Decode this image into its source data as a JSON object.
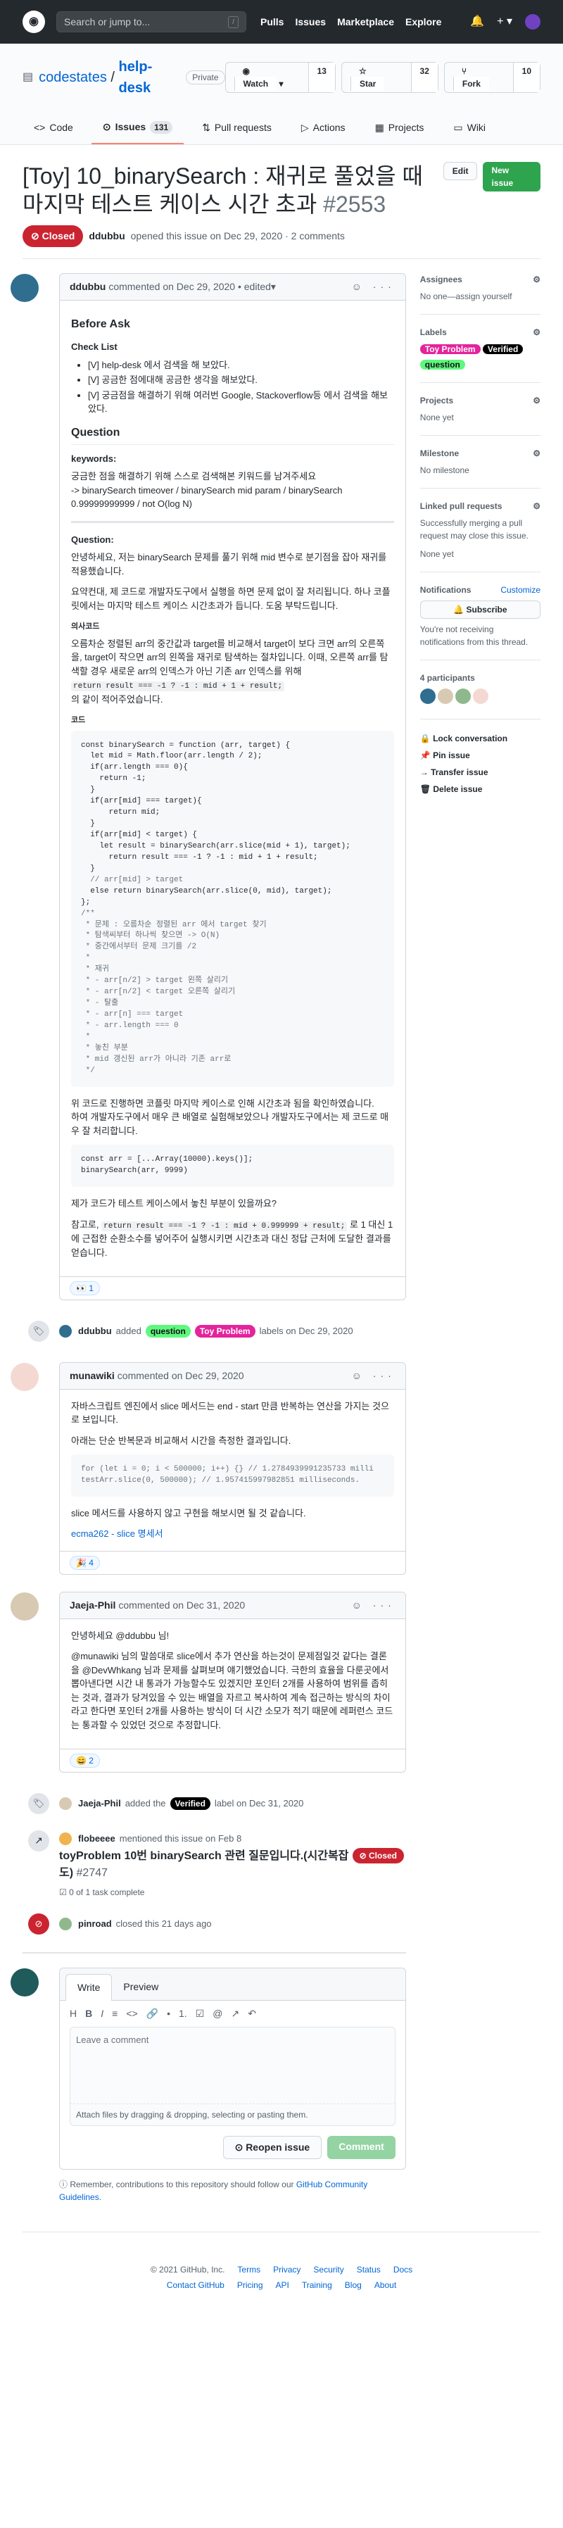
{
  "header": {
    "search_placeholder": "Search or jump to...",
    "search_key": "/",
    "nav": [
      "Pulls",
      "Issues",
      "Marketplace",
      "Explore"
    ]
  },
  "repo": {
    "owner": "codestates",
    "sep": " / ",
    "name": "help-desk",
    "visibility": "Private",
    "watch": "Watch",
    "watch_count": "13",
    "star": "Star",
    "star_count": "32",
    "fork": "Fork",
    "fork_count": "10"
  },
  "tabs": [
    {
      "label": "Code"
    },
    {
      "label": "Issues",
      "count": "131"
    },
    {
      "label": "Pull requests"
    },
    {
      "label": "Actions"
    },
    {
      "label": "Projects"
    },
    {
      "label": "Wiki"
    }
  ],
  "issue": {
    "title": "[Toy] 10_binarySearch : 재귀로 풀었을 때 마지막 테스트 케이스 시간 초과",
    "number": "#2553",
    "edit": "Edit",
    "new_issue": "New issue",
    "state": "Closed",
    "author": "ddubbu",
    "opened": "opened this issue on Dec 29, 2020 · 2 comments"
  },
  "c1": {
    "author": "ddubbu",
    "meta": "commented on Dec 29, 2020 • edited",
    "before_ask": "Before Ask",
    "checklist_title": "Check List",
    "checklist": [
      "[V] help-desk 에서 검색을 해 보았다.",
      "[V] 공금한 점에대해 공금한 생각을 해보았다.",
      "[V] 궁금점을 해결하기 위해 여러번 Google, Stackoverflow등 에서 검색을 해보았다."
    ],
    "question_h": "Question",
    "keywords_h": "keywords:",
    "kw1": "궁금한 점을 해결하기 위해 스스로 검색해본 키워드를 남겨주세요",
    "kw2": "-> binarySearch timeover / binarySearch mid param / binarySearch",
    "kw3": "0.99999999999 / not O(log N)",
    "q2_h": "Question:",
    "q_p1": "안녕하세요, 저는 binarySearch 문제를 풀기 위해 mid 변수로 분기점을 잡아 재귀를 적용했습니다.",
    "q_p2": "요약컨대, 제 코드로 개발자도구에서 실행을 하면 문제 없이 잘 처리됩니다. 하나 코플릿에서는 마지막 테스트 케이스 시간초과가 듭니다. 도움 부탁드립니다.",
    "shot_h": "의사코드",
    "q_p3": "오름차순 정렬된 arr의 중간값과 target를 비교해서 target이 보다 크면 arr의 오른쪽을, target이 작으면 arr의 왼쪽을 재귀로 탐색하는 절차입니다. 이때, 오른쪽 arr를 탐색할 경우 새로운 arr의 인덱스가 아닌 기존 arr 인덱스를 위해",
    "q_code": "return result === -1 ? -1 : mid + 1 + result;",
    "q_p4": "의 같이 적어주었습니다.",
    "code_h": "코드",
    "code": [
      "const binarySearch = function (arr, target) {",
      "  let mid = Math.floor(arr.length / 2);",
      "  if(arr.length === 0){",
      "    return -1;",
      "  }",
      "  if(arr[mid] === target){",
      "      return mid;",
      "  }",
      "  if(arr[mid] < target) {",
      "    let result = binarySearch(arr.slice(mid + 1), target);",
      "      return result === -1 ? -1 : mid + 1 + result;",
      "  }",
      "  // arr[mid] > target",
      "  else return binarySearch(arr.slice(0, mid), target);",
      "};",
      "/**",
      " * 문제 : 오름차순 정렬된 arr 에서 target 찾기",
      " * 탐색씨부터 하나씩 찾으면 -> O(N)",
      " * 중간에서부터 문제 크기를 /2",
      " *",
      " * 재귀",
      " * - arr[n/2] > target 왼쪽 살리기",
      " * - arr[n/2] < target 오른쪽 살리기",
      " * - 탈출",
      " * - arr[n] === target",
      " * - arr.length === 0",
      " *",
      " * 놓친 부분",
      " * mid 갱신된 arr가 아니라 기존 arr로",
      " */"
    ],
    "q_p5": "위 코드로 진행하면 코플릿 마지막 케이스로 인해 시간초과 됨을 확인하였습니다.",
    "q_p6": "하여 개발자도구에서 매우 큰 배열로 실험해보았으나 개발자도구에서는 제 코드로 매우 잘 처리합니다.",
    "code2": [
      "const arr = [...Array(10000).keys()];",
      "binarySearch(arr, 9999)"
    ],
    "q_p7": "제가 코드가 테스트 케이스에서 놓친 부분이 있을까요?",
    "q_p8a": "참고로,",
    "q_p8code": "return result === -1 ? -1 : mid + 0.999999 + result;",
    "q_p8b": "로 1 대신 1에 근접한 순환소수를 넣어주어 실행시키면 시간초과 대신 정답 근처에 도달한 결과를 얻습니다.",
    "reaction": "👀 1"
  },
  "ev1": {
    "actor": "ddubbu",
    "added": "added",
    "l1": "question",
    "l2": "Toy Problem",
    "suffix": "labels on Dec 29, 2020"
  },
  "c2": {
    "author": "munawiki",
    "meta": "commented on Dec 29, 2020",
    "p1": "자바스크립트 엔진에서 slice 메서드는 end - start 만큼 반복하는 연산을 가지는 것으로 보입니다.",
    "p2": "아래는 단순 반복문과 비교해서 시간을 측정한 결과입니다.",
    "code": [
      "for (let i = 0; i < 500000; i++) {} // 1.2784939991235733 milli",
      "testArr.slice(0, 500000); // 1.957415997982851 milliseconds."
    ],
    "p3": "slice 메서드를 사용하지 않고 구현을 해보시면 될 것 같습니다.",
    "link": "ecma262 - slice 명세서",
    "reaction": "🎉 4"
  },
  "c3": {
    "author": "Jaeja-Phil",
    "meta": "commented on Dec 31, 2020",
    "p1": "안녕하세요 @ddubbu 님!",
    "p2": "@munawiki 님의 말씀대로 slice에서 추가 연산을 하는것이 문제점일것 같다는 결론을 @DevWhkang 님과 문제를 살펴보며 얘기했었습니다. 극한의 효율을 다룬곳에서 뽑아낸다면 시간 내 통과가 가능할수도 있겠지만 포인터 2개를 사용하여 범위를 좁히는 것과, 결과가 당겨있을 수 있는 배열을 자르고 복사하여 계속 접근하는 방식의 차이라고 한다면 포인터 2개를 사용하는 방식이 더 시간 소모가 적기 때문에 레퍼런스 코드는 통과할 수 있었던 것으로 추정합니다.",
    "reaction": "😄 2"
  },
  "ev2": {
    "actor": "Jaeja-Phil",
    "text": "added the",
    "label": "Verified",
    "suffix": "label on Dec 31, 2020"
  },
  "xref": {
    "actor": "flobeeee",
    "text": "mentioned this issue on Feb 8",
    "title": "toyProblem 10번 binarySearch 관련 질문입니다.(시간복잡도)",
    "number": "#2747",
    "state": "Closed",
    "progress": "0 of 1 task complete"
  },
  "ev3": {
    "actor": "pinroad",
    "text": "closed this 21 days ago"
  },
  "newc": {
    "write": "Write",
    "preview": "Preview",
    "toolbar": [
      "H",
      "B",
      "I",
      "≡",
      "<>",
      "🔗",
      "•",
      "1.",
      "☑",
      "@",
      "↗",
      "↶"
    ],
    "placeholder": "Leave a comment",
    "attach": "Attach files by dragging & dropping, selecting or pasting them.",
    "reopen": "Reopen issue",
    "comment": "Comment",
    "remember": "Remember, contributions to this repository should follow our",
    "guidelines": "GitHub Community Guidelines."
  },
  "sidebar": {
    "assignees": "Assignees",
    "assignees_v": "No one—assign yourself",
    "labels": "Labels",
    "label_items": [
      "Toy Problem",
      "Verified",
      "question"
    ],
    "projects": "Projects",
    "projects_v": "None yet",
    "milestone": "Milestone",
    "milestone_v": "No milestone",
    "linked": "Linked pull requests",
    "linked_v": "Successfully merging a pull request may close this issue.",
    "linked_v2": "None yet",
    "notifications": "Notifications",
    "customize": "Customize",
    "subscribe": "Subscribe",
    "notif_v": "You're not receiving notifications from this thread.",
    "participants": "4 participants",
    "lock": "Lock conversation",
    "pin": "Pin issue",
    "transfer": "Transfer issue",
    "delete": "Delete issue"
  },
  "footer": {
    "copy": "© 2021 GitHub, Inc.",
    "row1": [
      "Terms",
      "Privacy",
      "Security",
      "Status",
      "Docs"
    ],
    "row2": [
      "Contact GitHub",
      "Pricing",
      "API",
      "Training",
      "Blog",
      "About"
    ]
  },
  "colors": {
    "closed": "#cb2431",
    "question": "#5ef87e",
    "toy": "#e5239c",
    "verified": "#000000"
  }
}
